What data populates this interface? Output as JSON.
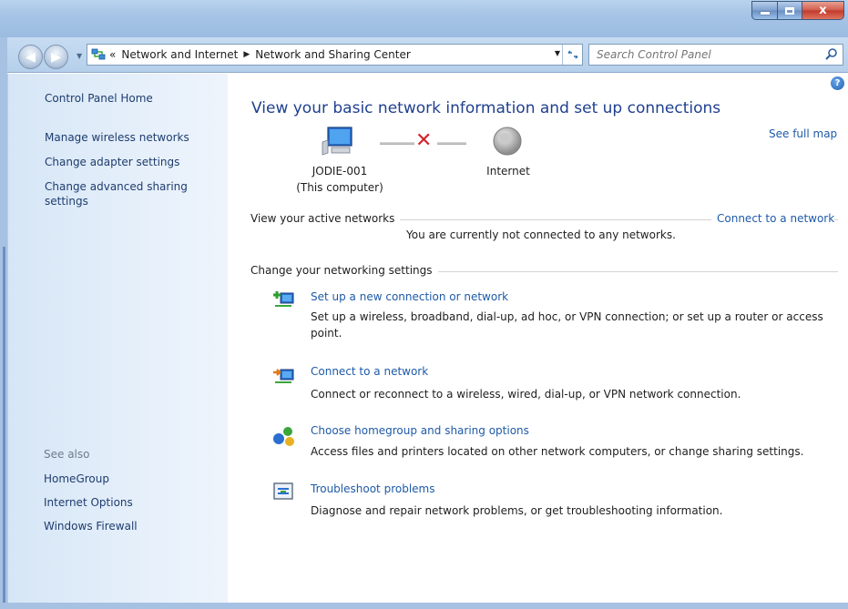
{
  "window": {
    "minimize_label": "",
    "maximize_label": "",
    "close_label": "x"
  },
  "address": {
    "overflow": "«",
    "crumbs": [
      "Network and Internet",
      "Network and Sharing Center"
    ]
  },
  "search": {
    "placeholder": "Search Control Panel"
  },
  "sidebar": {
    "home": "Control Panel Home",
    "links": [
      "Manage wireless networks",
      "Change adapter settings",
      "Change advanced sharing settings"
    ],
    "see_also_label": "See also",
    "see_also": [
      "HomeGroup",
      "Internet Options",
      "Windows Firewall"
    ]
  },
  "main": {
    "title": "View your basic network information and set up connections",
    "see_full_map": "See full map",
    "computer_name": "JODIE-001",
    "computer_sub": "(This computer)",
    "internet_label": "Internet",
    "active_networks_label": "View your active networks",
    "connect_to_network": "Connect to a network",
    "not_connected": "You are currently not connected to any networks.",
    "change_settings_label": "Change your networking settings",
    "tasks": [
      {
        "link": "Set up a new connection or network",
        "desc": "Set up a wireless, broadband, dial-up, ad hoc, or VPN connection; or set up a router or access point."
      },
      {
        "link": "Connect to a network",
        "desc": "Connect or reconnect to a wireless, wired, dial-up, or VPN network connection."
      },
      {
        "link": "Choose homegroup and sharing options",
        "desc": "Access files and printers located on other network computers, or change sharing settings."
      },
      {
        "link": "Troubleshoot problems",
        "desc": "Diagnose and repair network problems, or get troubleshooting information."
      }
    ]
  },
  "icons": {
    "back": "back-arrow-icon",
    "forward": "forward-arrow-icon",
    "refresh": "refresh-icon",
    "search": "search-icon",
    "help": "help-icon"
  },
  "colors": {
    "link": "#1e5aa8",
    "title": "#1f3f8f",
    "sidebar_bg": "#e3eefa",
    "error_red": "#d0232a"
  }
}
